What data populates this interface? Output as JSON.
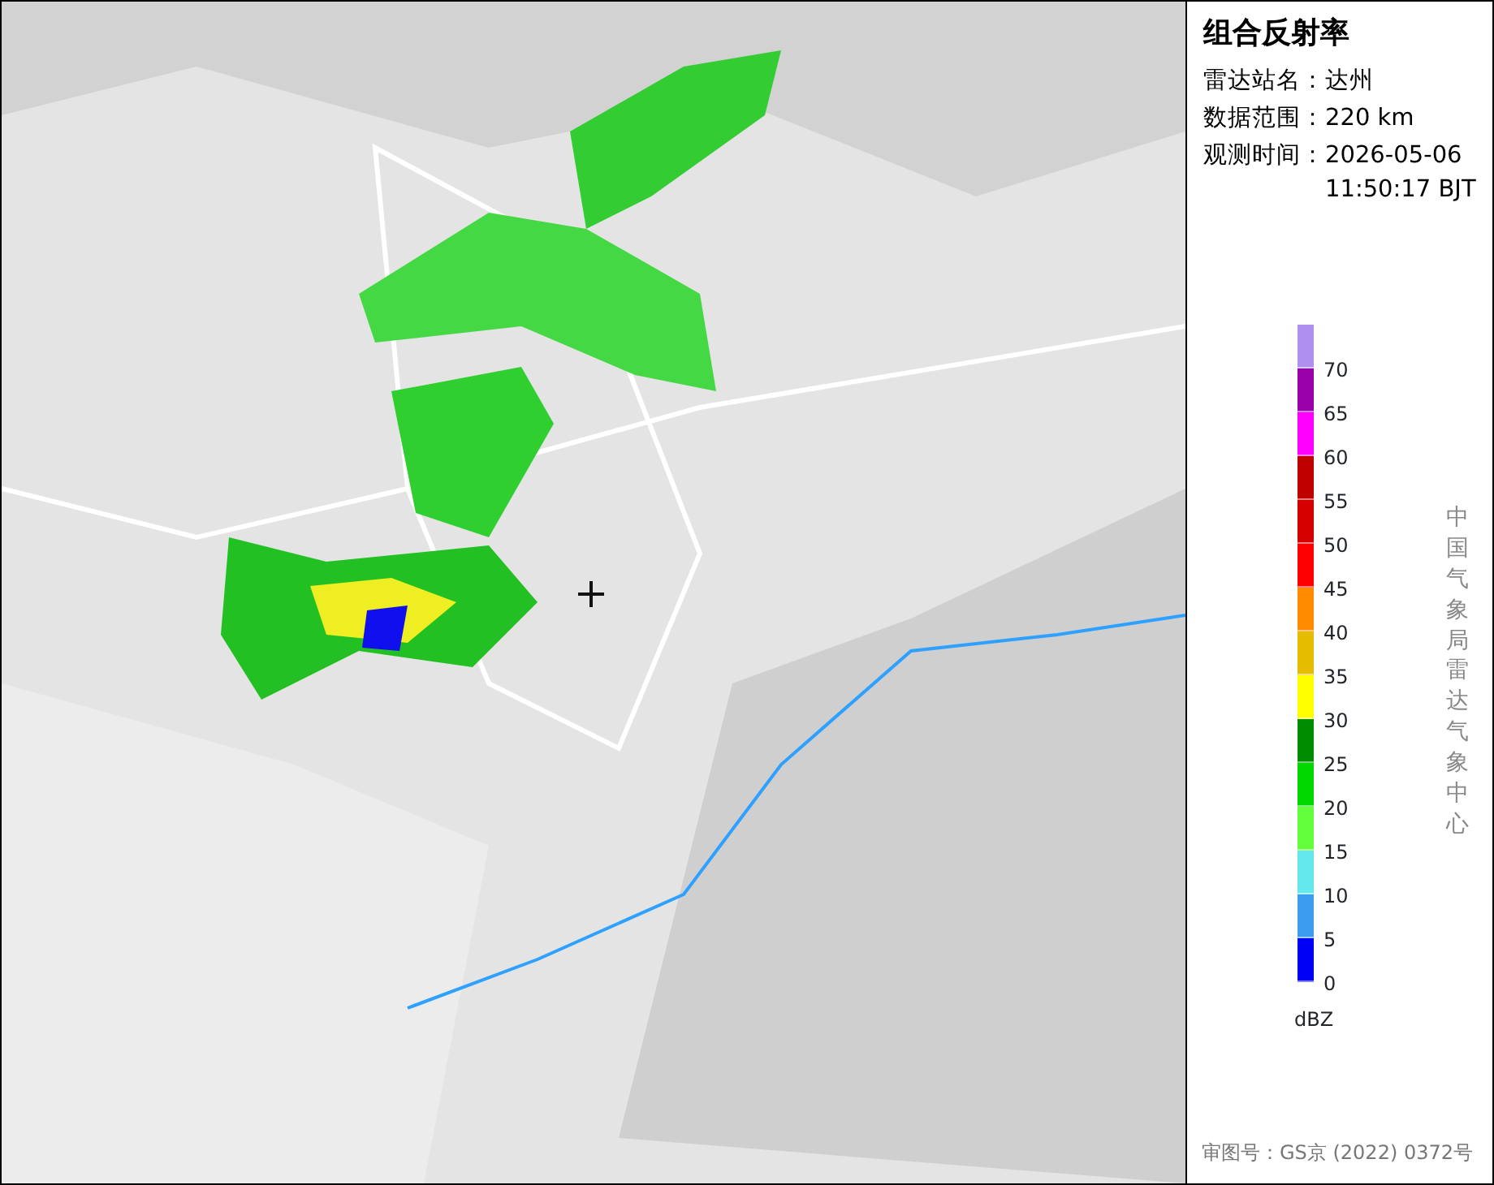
{
  "panel": {
    "title": "组合反射率",
    "info": [
      {
        "label": "雷达站名：",
        "value": "达州"
      },
      {
        "label": "数据范围：",
        "value": "220 km"
      },
      {
        "label": "观测时间：",
        "value": "2026-05-06\n11:50:17 BJT"
      }
    ],
    "legend": {
      "unit": "dBZ",
      "items": [
        {
          "label": "70",
          "color": "#ad90f0"
        },
        {
          "label": "65",
          "color": "#9800aa"
        },
        {
          "label": "60",
          "color": "#ff00ff"
        },
        {
          "label": "55",
          "color": "#c00000"
        },
        {
          "label": "50",
          "color": "#d60000"
        },
        {
          "label": "45",
          "color": "#ff0000"
        },
        {
          "label": "40",
          "color": "#ff8c00"
        },
        {
          "label": "35",
          "color": "#e6bc00"
        },
        {
          "label": "30",
          "color": "#ffff00"
        },
        {
          "label": "25",
          "color": "#008c00"
        },
        {
          "label": "20",
          "color": "#00d800"
        },
        {
          "label": "15",
          "color": "#64ff3c"
        },
        {
          "label": "10",
          "color": "#64e8ee"
        },
        {
          "label": "5",
          "color": "#3c9df0"
        },
        {
          "label": "0",
          "color": "#0000f6"
        }
      ]
    },
    "credit": "中国气象局雷达气象中心",
    "footer": "审图号：GS京 (2022) 0372号"
  }
}
